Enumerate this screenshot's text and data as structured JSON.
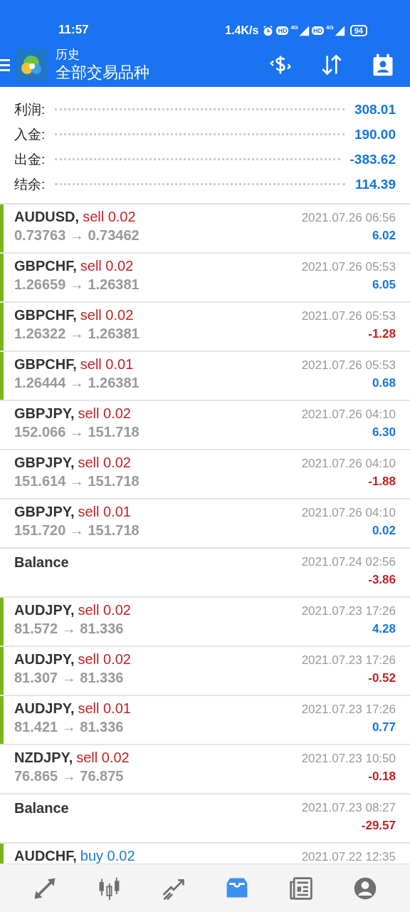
{
  "status_bar": {
    "time": "11:57",
    "speed": "1.4K/s",
    "battery": "94",
    "net_labels": [
      "HD",
      "4G",
      "HD",
      "4G"
    ]
  },
  "app_bar": {
    "subtitle": "历史",
    "title": "全部交易品种"
  },
  "summary": [
    {
      "label": "利润:",
      "value": "308.01"
    },
    {
      "label": "入金:",
      "value": "190.00"
    },
    {
      "label": "出金:",
      "value": "-383.62"
    },
    {
      "label": "结余:",
      "value": "114.39"
    }
  ],
  "deals": [
    {
      "kind": "trade",
      "symbol": "AUDUSD,",
      "color": "#c41f22",
      "action": "sell 0.02",
      "prices": "0.73763 → 0.73462",
      "time": "2021.07.26 06:56",
      "profit": "6.02",
      "loss": false,
      "marked": true
    },
    {
      "kind": "trade",
      "symbol": "GBPCHF,",
      "color": "#c41f22",
      "action": "sell 0.02",
      "prices": "1.26659 → 1.26381",
      "time": "2021.07.26 05:53",
      "profit": "6.05",
      "loss": false,
      "marked": true
    },
    {
      "kind": "trade",
      "symbol": "GBPCHF,",
      "color": "#c41f22",
      "action": "sell 0.02",
      "prices": "1.26322 → 1.26381",
      "time": "2021.07.26 05:53",
      "profit": "-1.28",
      "loss": true,
      "marked": true
    },
    {
      "kind": "trade",
      "symbol": "GBPCHF,",
      "color": "#c41f22",
      "action": "sell 0.01",
      "prices": "1.26444 → 1.26381",
      "time": "2021.07.26 05:53",
      "profit": "0.68",
      "loss": false,
      "marked": true
    },
    {
      "kind": "trade",
      "symbol": "GBPJPY,",
      "color": "#c41f22",
      "action": "sell 0.02",
      "prices": "152.066 → 151.718",
      "time": "2021.07.26 04:10",
      "profit": "6.30",
      "loss": false,
      "marked": false
    },
    {
      "kind": "trade",
      "symbol": "GBPJPY,",
      "color": "#c41f22",
      "action": "sell 0.02",
      "prices": "151.614 → 151.718",
      "time": "2021.07.26 04:10",
      "profit": "-1.88",
      "loss": true,
      "marked": false
    },
    {
      "kind": "trade",
      "symbol": "GBPJPY,",
      "color": "#c41f22",
      "action": "sell 0.01",
      "prices": "151.720 → 151.718",
      "time": "2021.07.26 04:10",
      "profit": "0.02",
      "loss": false,
      "marked": false
    },
    {
      "kind": "balance",
      "symbol": "Balance",
      "time": "2021.07.24 02:56",
      "profit": "-3.86",
      "loss": true,
      "marked": false
    },
    {
      "kind": "trade",
      "symbol": "AUDJPY,",
      "color": "#c41f22",
      "action": "sell 0.02",
      "prices": "81.572 → 81.336",
      "time": "2021.07.23 17:26",
      "profit": "4.28",
      "loss": false,
      "marked": true
    },
    {
      "kind": "trade",
      "symbol": "AUDJPY,",
      "color": "#c41f22",
      "action": "sell 0.02",
      "prices": "81.307 → 81.336",
      "time": "2021.07.23 17:26",
      "profit": "-0.52",
      "loss": true,
      "marked": true
    },
    {
      "kind": "trade",
      "symbol": "AUDJPY,",
      "color": "#c41f22",
      "action": "sell 0.01",
      "prices": "81.421 → 81.336",
      "time": "2021.07.23 17:26",
      "profit": "0.77",
      "loss": false,
      "marked": true
    },
    {
      "kind": "trade",
      "symbol": "NZDJPY,",
      "color": "#c41f22",
      "action": "sell 0.02",
      "prices": "76.865 → 76.875",
      "time": "2021.07.23 10:50",
      "profit": "-0.18",
      "loss": true,
      "marked": false
    },
    {
      "kind": "balance",
      "symbol": "Balance",
      "time": "2021.07.23 08:27",
      "profit": "-29.57",
      "loss": true,
      "marked": false
    },
    {
      "kind": "trade",
      "symbol": "AUDCHF,",
      "color": "#1a7ad6",
      "action": "buy 0.02",
      "time": "2021.07.22 12:35",
      "marked": true
    }
  ],
  "nav": [
    {
      "kind": "quotes",
      "selected": false
    },
    {
      "kind": "chart",
      "selected": false
    },
    {
      "kind": "trade",
      "selected": false
    },
    {
      "kind": "history",
      "selected": true
    },
    {
      "kind": "news",
      "selected": false
    },
    {
      "kind": "avatar",
      "selected": false
    }
  ]
}
